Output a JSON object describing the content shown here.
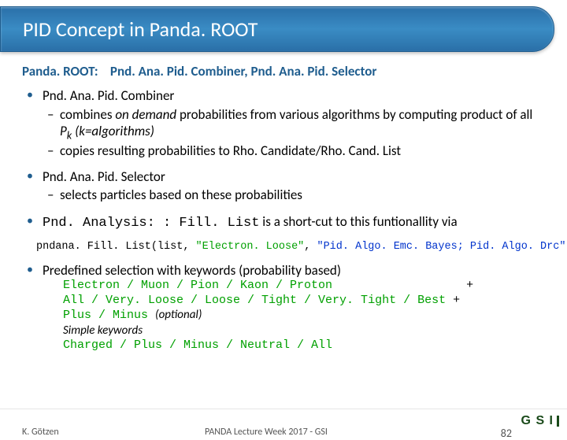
{
  "title": "PID Concept in Panda. ROOT",
  "subtitle_prefix": "Panda. ROOT:",
  "subtitle_main": "Pnd. Ana. Pid. Combiner, Pnd. Ana. Pid. Selector",
  "b1": {
    "head": "Pnd. Ana. Pid. Combiner",
    "s1a": "combines ",
    "s1b": "on demand",
    "s1c": " probabilities from     various algorithms by computing product of all      ",
    "s1d": "P",
    "s1e": "k",
    "s1f": "  (k=algorithms)",
    "s2": "copies resulting probabilities to Rho. Candidate/Rho. Cand. List"
  },
  "b2": {
    "head": "Pnd. Ana. Pid. Selector",
    "s1": "selects particles based on these probabilities"
  },
  "b3": {
    "head": "Pnd. Analysis: : Fill. List",
    "tail": "     is a short-cut to this funtionallity via"
  },
  "code": {
    "a": "pndana. Fill. List(list, ",
    "b": "\"Electron. Loose\"",
    "c": ", ",
    "d": "\"Pid. Algo. Emc. Bayes; Pid. Algo. Drc\"",
    "e": ");"
  },
  "b4": {
    "head": "Predefined selection with keywords (probability based)",
    "l1a": "Electron / Muon / Pion / Kaon / Proton",
    "l1b": "+",
    "l2a": "All / Very. Loose / Loose / Tight / Very. Tight / Best",
    "l2b": " +",
    "l3a": "Plus / Minus ",
    "l3b": "(optional)",
    "l4": "Simple keywords",
    "l5": "Charged / Plus / Minus / Neutral / All"
  },
  "footer": {
    "author": "K. Götzen",
    "conf": "PANDA Lecture Week 2017 - GSI",
    "page": "82"
  }
}
